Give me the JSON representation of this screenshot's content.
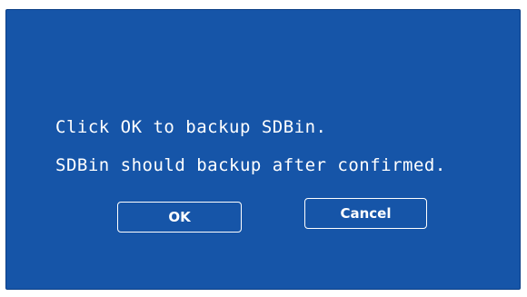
{
  "dialog": {
    "message_line1": "Click OK to backup SDBin.",
    "message_line2": "SDBin should backup after confirmed.",
    "ok_label": "OK",
    "cancel_label": "Cancel"
  },
  "colors": {
    "dialog_background": "#1655a8",
    "text": "#ffffff",
    "button_border": "#ffffff"
  }
}
